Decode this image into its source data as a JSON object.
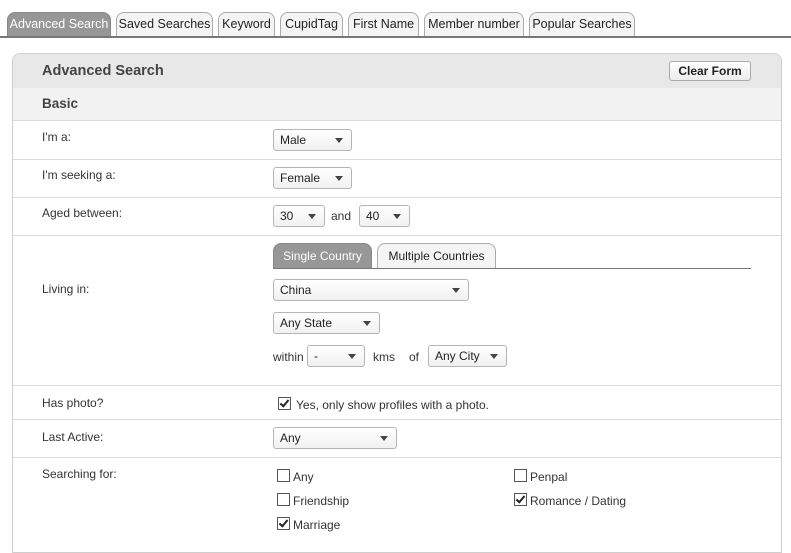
{
  "tabs": [
    {
      "label": "Advanced Search",
      "active": true
    },
    {
      "label": "Saved Searches",
      "active": false
    },
    {
      "label": "Keyword",
      "active": false
    },
    {
      "label": "CupidTag",
      "active": false
    },
    {
      "label": "First Name",
      "active": false
    },
    {
      "label": "Member number",
      "active": false
    },
    {
      "label": "Popular Searches",
      "active": false
    }
  ],
  "panel": {
    "title": "Advanced Search",
    "clear_label": "Clear Form",
    "section_title": "Basic"
  },
  "form": {
    "im_a": {
      "label": "I'm a:",
      "value": "Male"
    },
    "seeking": {
      "label": "I'm seeking a:",
      "value": "Female"
    },
    "aged": {
      "label": "Aged between:",
      "min": "30",
      "and": "and",
      "max": "40"
    },
    "living": {
      "label": "Living in:",
      "tabs": [
        {
          "label": "Single Country",
          "active": true
        },
        {
          "label": "Multiple Countries",
          "active": false
        }
      ],
      "country": "China",
      "state": "Any State",
      "within_label": "within",
      "distance": "-",
      "kms_label": "kms",
      "of_label": "of",
      "city": "Any City"
    },
    "photo": {
      "label": "Has photo?",
      "checkbox_label": "Yes, only show profiles with a photo.",
      "checked": true
    },
    "last_active": {
      "label": "Last Active:",
      "value": "Any"
    },
    "searching_for": {
      "label": "Searching for:",
      "options": [
        {
          "label": "Any",
          "checked": false
        },
        {
          "label": "Penpal",
          "checked": false
        },
        {
          "label": "Friendship",
          "checked": false
        },
        {
          "label": "Romance / Dating",
          "checked": true
        },
        {
          "label": "Marriage",
          "checked": true
        }
      ]
    }
  }
}
